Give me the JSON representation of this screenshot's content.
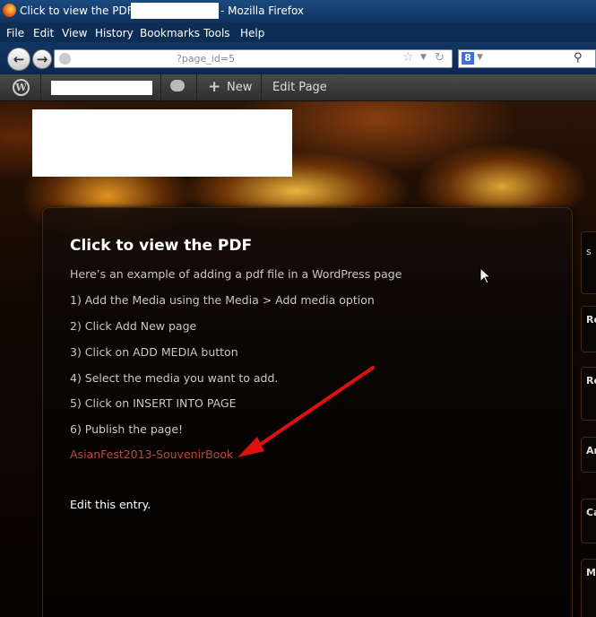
{
  "window": {
    "title_prefix": "Click to view the PDF «",
    "title_suffix": "- Mozilla Firefox"
  },
  "menu": [
    "File",
    "Edit",
    "View",
    "History",
    "Bookmarks",
    "Tools",
    "Help"
  ],
  "nav": {
    "url_fragment": "?page_id=5",
    "search_engine_icon": "google-icon",
    "search_engine_letter": "8"
  },
  "admin_bar": {
    "new_label": "New",
    "edit_label": "Edit Page"
  },
  "post": {
    "title": "Click to view the PDF",
    "lines": [
      "Here’s an example of adding a pdf file in a WordPress page",
      "1) Add the Media using the Media > Add media option",
      "2) Click Add New page",
      "3) Click on ADD MEDIA button",
      "4) Select the media you want to add.",
      "5) Click on INSERT INTO PAGE",
      "6) Publish the page!"
    ],
    "pdf_link": "AsianFest2013-SouvenirBook",
    "edit_link": "Edit this entry."
  },
  "sidebar": {
    "labels": [
      "s",
      "Re",
      "Re",
      "Ar",
      "Ca",
      "M"
    ]
  },
  "colors": {
    "link": "#b94a3a",
    "arrow": "#e01010",
    "titlebar": "#1b4a7d"
  }
}
